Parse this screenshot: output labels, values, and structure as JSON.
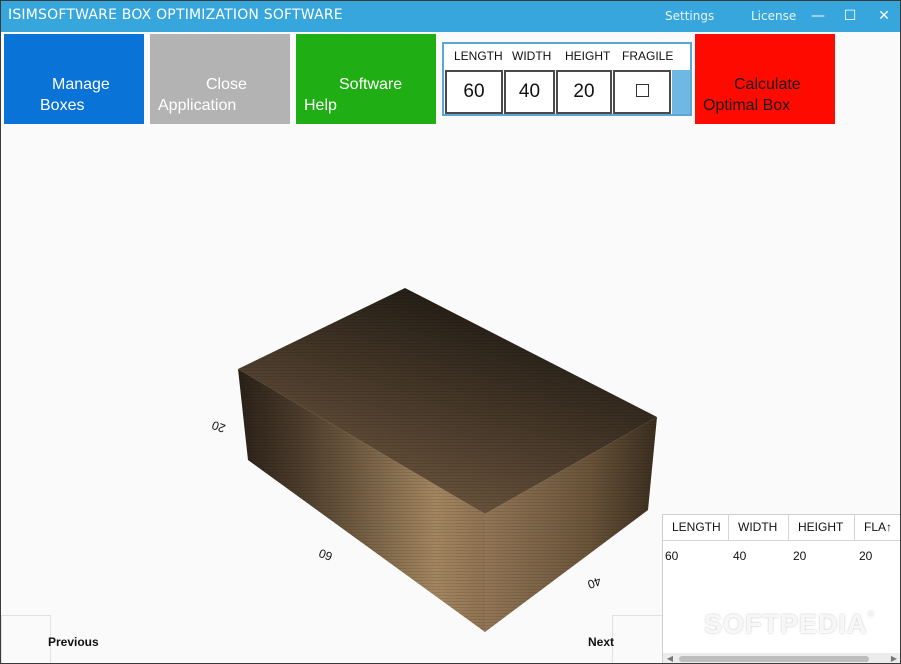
{
  "titlebar": {
    "title": "ISIMSOFTWARE BOX OPTIMIZATION SOFTWARE",
    "settings": "Settings",
    "license": "License",
    "minimize": "—",
    "maximize": "☐",
    "close": "✕"
  },
  "toolbar": {
    "manage": {
      "line1": "Manage",
      "line2": "Boxes",
      "color": "#0a73d8"
    },
    "close_app": {
      "line1": "Close",
      "line2": "Application",
      "color": "#b3b3b3"
    },
    "help": {
      "line1": "Software",
      "line2": "Help",
      "color": "#1fae13"
    },
    "calculate": {
      "line1": "Calculate",
      "line2": "Optimal Box",
      "color": "#ff0a00"
    }
  },
  "dimensions": {
    "headers": {
      "length": "LENGTH",
      "width": "WIDTH",
      "height": "HEIGHT",
      "fragile": "FRAGILE"
    },
    "values": {
      "length": "60",
      "width": "40",
      "height": "20"
    },
    "fragile_checked": false
  },
  "viewport": {
    "labels": {
      "length": "60",
      "width": "40",
      "height": "20"
    },
    "box_color": "#8a6d4a"
  },
  "nav": {
    "previous": "Previous",
    "next": "Next"
  },
  "results": {
    "headers": [
      "LENGTH",
      "WIDTH",
      "HEIGHT",
      "FLA"
    ],
    "sort_icon": "↑",
    "rows": [
      [
        "60",
        "40",
        "20",
        "20"
      ]
    ]
  },
  "watermark": {
    "text": "SOFTPEDIA",
    "mark": "®"
  }
}
